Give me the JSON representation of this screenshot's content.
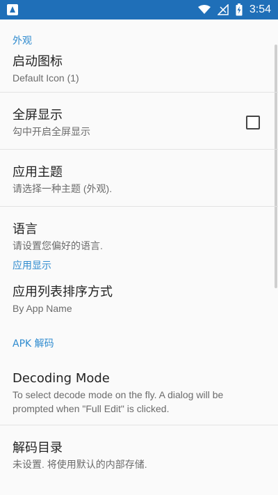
{
  "status_bar": {
    "time": "3:54"
  },
  "sections": [
    {
      "header": "外观",
      "items": [
        {
          "title": "启动图标",
          "subtitle": "Default Icon (1)"
        },
        {
          "title": "全屏显示",
          "subtitle": "勾中开启全屏显示",
          "checked": false
        },
        {
          "title": "应用主题",
          "subtitle": "请选择一种主题 (外观)."
        },
        {
          "title": "语言",
          "subtitle": "请设置您偏好的语言."
        }
      ]
    },
    {
      "header": "应用显示",
      "items": [
        {
          "title": "应用列表排序方式",
          "subtitle": "By App Name"
        }
      ]
    },
    {
      "header": "APK 解码",
      "items": [
        {
          "title": "Decoding Mode",
          "subtitle": "To select decode mode on the fly. A dialog will be prompted when \"Full Edit\" is clicked."
        },
        {
          "title": "解码目录",
          "subtitle": "未设置. 将使用默认的内部存储."
        }
      ]
    }
  ]
}
